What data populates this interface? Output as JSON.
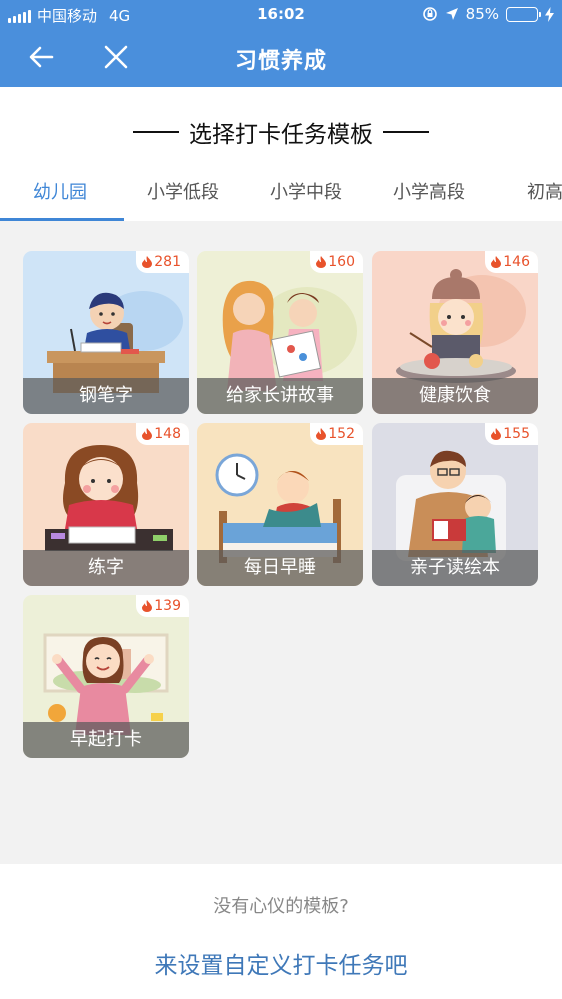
{
  "status_bar": {
    "carrier": "中国移动",
    "network": "4G",
    "time": "16:02",
    "battery": "85%",
    "battery_level": 0.85
  },
  "nav": {
    "title": "习惯养成",
    "back_icon": "back-arrow-icon",
    "close_icon": "close-icon"
  },
  "heading": "选择打卡任务模板",
  "tabs": [
    {
      "label": "幼儿园",
      "active": true
    },
    {
      "label": "小学低段",
      "active": false
    },
    {
      "label": "小学中段",
      "active": false
    },
    {
      "label": "小学高段",
      "active": false
    },
    {
      "label": "初高",
      "active": false
    }
  ],
  "templates": [
    {
      "name": "钢笔字",
      "count": "281"
    },
    {
      "name": "给家长讲故事",
      "count": "160"
    },
    {
      "name": "健康饮食",
      "count": "146"
    },
    {
      "name": "练字",
      "count": "148"
    },
    {
      "name": "每日早睡",
      "count": "152"
    },
    {
      "name": "亲子读绘本",
      "count": "155"
    },
    {
      "name": "早起打卡",
      "count": "139"
    }
  ],
  "footer": {
    "hint": "没有心仪的模板?",
    "link": "来设置自定义打卡任务吧"
  },
  "colors": {
    "primary": "#4a8fdc",
    "tab_active": "#3f86d6",
    "count": "#e8522b",
    "link": "#3f78b8"
  }
}
